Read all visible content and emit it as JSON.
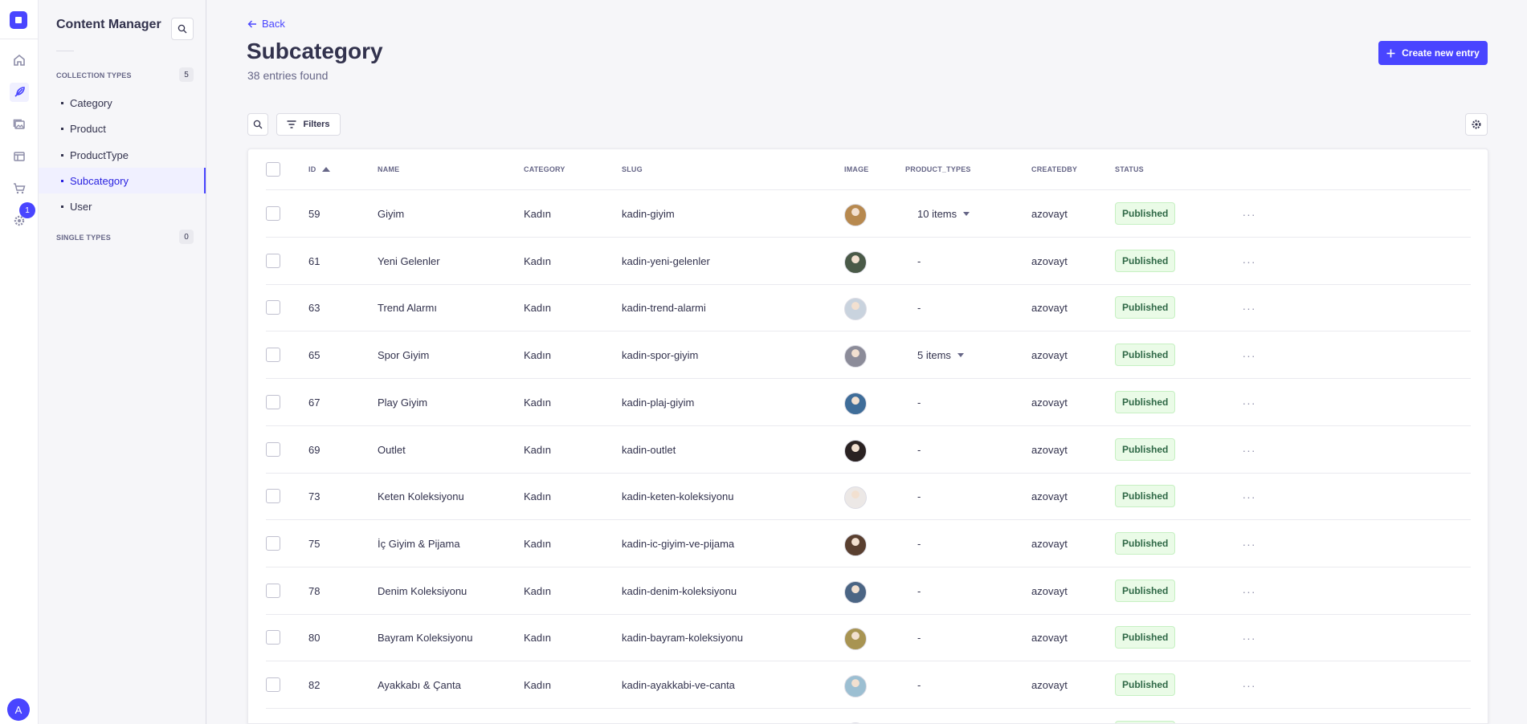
{
  "rail": {
    "badge_count": "1",
    "avatar_initial": "A"
  },
  "sidebar": {
    "title": "Content Manager",
    "collection_label": "COLLECTION TYPES",
    "collection_count": "5",
    "items": [
      {
        "label": "Category"
      },
      {
        "label": "Product"
      },
      {
        "label": "ProductType"
      },
      {
        "label": "Subcategory"
      },
      {
        "label": "User"
      }
    ],
    "single_label": "SINGLE TYPES",
    "single_count": "0"
  },
  "header": {
    "back_label": "Back",
    "title": "Subcategory",
    "subtitle": "38 entries found",
    "create_label": "Create new entry"
  },
  "toolbar": {
    "filters_label": "Filters"
  },
  "table": {
    "columns": [
      "ID",
      "NAME",
      "CATEGORY",
      "SLUG",
      "IMAGE",
      "PRODUCT_TYPES",
      "CREATEDBY",
      "STATUS"
    ],
    "rows": [
      {
        "id": "59",
        "name": "Giyim",
        "category": "Kadın",
        "slug": "kadin-giyim",
        "product_types": "10 items",
        "createdby": "azovayt",
        "status": "Published",
        "thumb": "#b7894f"
      },
      {
        "id": "61",
        "name": "Yeni Gelenler",
        "category": "Kadın",
        "slug": "kadin-yeni-gelenler",
        "product_types": "-",
        "createdby": "azovayt",
        "status": "Published",
        "thumb": "#4a5a48"
      },
      {
        "id": "63",
        "name": "Trend Alarmı",
        "category": "Kadın",
        "slug": "kadin-trend-alarmi",
        "product_types": "-",
        "createdby": "azovayt",
        "status": "Published",
        "thumb": "#c9d3de"
      },
      {
        "id": "65",
        "name": "Spor Giyim",
        "category": "Kadın",
        "slug": "kadin-spor-giyim",
        "product_types": "5 items",
        "createdby": "azovayt",
        "status": "Published",
        "thumb": "#8c8c99"
      },
      {
        "id": "67",
        "name": "Play Giyim",
        "category": "Kadın",
        "slug": "kadin-plaj-giyim",
        "product_types": "-",
        "createdby": "azovayt",
        "status": "Published",
        "thumb": "#3f6d99"
      },
      {
        "id": "69",
        "name": "Outlet",
        "category": "Kadın",
        "slug": "kadin-outlet",
        "product_types": "-",
        "createdby": "azovayt",
        "status": "Published",
        "thumb": "#2a2222"
      },
      {
        "id": "73",
        "name": "Keten Koleksiyonu",
        "category": "Kadın",
        "slug": "kadin-keten-koleksiyonu",
        "product_types": "-",
        "createdby": "azovayt",
        "status": "Published",
        "thumb": "#ece8e6"
      },
      {
        "id": "75",
        "name": "İç Giyim & Pijama",
        "category": "Kadın",
        "slug": "kadin-ic-giyim-ve-pijama",
        "product_types": "-",
        "createdby": "azovayt",
        "status": "Published",
        "thumb": "#5a4030"
      },
      {
        "id": "78",
        "name": "Denim Koleksiyonu",
        "category": "Kadın",
        "slug": "kadin-denim-koleksiyonu",
        "product_types": "-",
        "createdby": "azovayt",
        "status": "Published",
        "thumb": "#4b6584"
      },
      {
        "id": "80",
        "name": "Bayram Koleksiyonu",
        "category": "Kadın",
        "slug": "kadin-bayram-koleksiyonu",
        "product_types": "-",
        "createdby": "azovayt",
        "status": "Published",
        "thumb": "#a89452"
      },
      {
        "id": "82",
        "name": "Ayakkabı & Çanta",
        "category": "Kadın",
        "slug": "kadin-ayakkabi-ve-canta",
        "product_types": "-",
        "createdby": "azovayt",
        "status": "Published",
        "thumb": "#9cbfd2"
      }
    ],
    "partial_row": {
      "thumb": "#a08a6a",
      "status": "Published"
    }
  },
  "colors": {
    "primary": "#4945ff",
    "published_bg": "#eafbe7",
    "published_text": "#2f6846"
  }
}
